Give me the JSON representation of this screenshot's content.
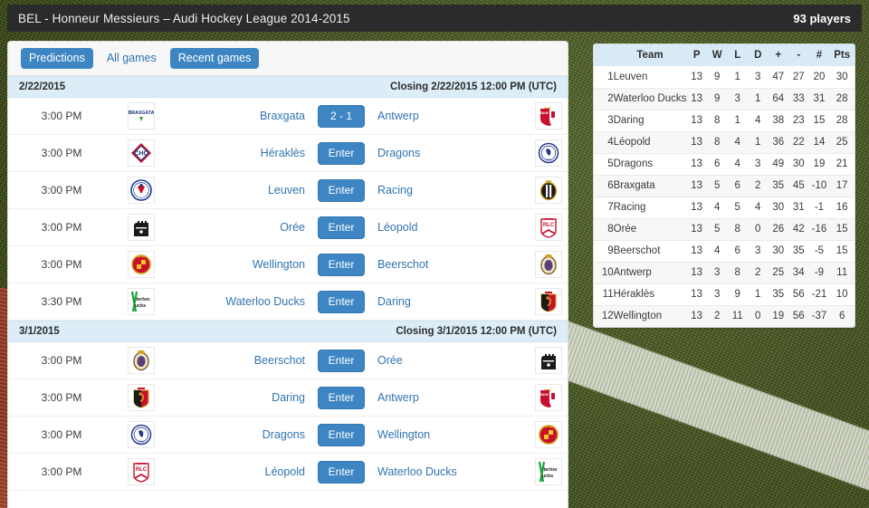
{
  "topbar": {
    "title": "BEL - Honneur Messieurs – Audi Hockey League 2014-2015",
    "players": "93 players"
  },
  "tabs": [
    {
      "label": "Predictions",
      "active": true
    },
    {
      "label": "All games",
      "active": false
    },
    {
      "label": "Recent games",
      "active": true
    }
  ],
  "sections": [
    {
      "date": "2/22/2015",
      "closing": "Closing 2/22/2015 12:00 PM (UTC)",
      "games": [
        {
          "time": "3:00 PM",
          "home": "Braxgata",
          "away": "Antwerp",
          "button": "2 - 1",
          "home_crest": "braxgata",
          "away_crest": "antwerp"
        },
        {
          "time": "3:00 PM",
          "home": "Héraklès",
          "away": "Dragons",
          "button": "Enter",
          "home_crest": "herakles",
          "away_crest": "dragons"
        },
        {
          "time": "3:00 PM",
          "home": "Leuven",
          "away": "Racing",
          "button": "Enter",
          "home_crest": "leuven",
          "away_crest": "racing"
        },
        {
          "time": "3:00 PM",
          "home": "Orée",
          "away": "Léopold",
          "button": "Enter",
          "home_crest": "oree",
          "away_crest": "leopold"
        },
        {
          "time": "3:00 PM",
          "home": "Wellington",
          "away": "Beerschot",
          "button": "Enter",
          "home_crest": "wellington",
          "away_crest": "beerschot"
        },
        {
          "time": "3:30 PM",
          "home": "Waterloo Ducks",
          "away": "Daring",
          "button": "Enter",
          "home_crest": "waterloo",
          "away_crest": "daring"
        }
      ]
    },
    {
      "date": "3/1/2015",
      "closing": "Closing 3/1/2015 12:00 PM (UTC)",
      "games": [
        {
          "time": "3:00 PM",
          "home": "Beerschot",
          "away": "Orée",
          "button": "Enter",
          "home_crest": "beerschot",
          "away_crest": "oree"
        },
        {
          "time": "3:00 PM",
          "home": "Daring",
          "away": "Antwerp",
          "button": "Enter",
          "home_crest": "daring",
          "away_crest": "antwerp"
        },
        {
          "time": "3:00 PM",
          "home": "Dragons",
          "away": "Wellington",
          "button": "Enter",
          "home_crest": "dragons",
          "away_crest": "wellington"
        },
        {
          "time": "3:00 PM",
          "home": "Léopold",
          "away": "Waterloo Ducks",
          "button": "Enter",
          "home_crest": "leopold",
          "away_crest": "waterloo"
        }
      ]
    }
  ],
  "standings": {
    "headers": [
      "",
      "Team",
      "P",
      "W",
      "L",
      "D",
      "+",
      "-",
      "#",
      "Pts"
    ],
    "rows": [
      {
        "rank": "1",
        "team": "Leuven",
        "p": "13",
        "w": "9",
        "l": "1",
        "d": "3",
        "gf": "47",
        "ga": "27",
        "gd": "20",
        "pts": "30"
      },
      {
        "rank": "2",
        "team": "Waterloo Ducks",
        "p": "13",
        "w": "9",
        "l": "3",
        "d": "1",
        "gf": "64",
        "ga": "33",
        "gd": "31",
        "pts": "28"
      },
      {
        "rank": "3",
        "team": "Daring",
        "p": "13",
        "w": "8",
        "l": "1",
        "d": "4",
        "gf": "38",
        "ga": "23",
        "gd": "15",
        "pts": "28"
      },
      {
        "rank": "4",
        "team": "Léopold",
        "p": "13",
        "w": "8",
        "l": "4",
        "d": "1",
        "gf": "36",
        "ga": "22",
        "gd": "14",
        "pts": "25"
      },
      {
        "rank": "5",
        "team": "Dragons",
        "p": "13",
        "w": "6",
        "l": "4",
        "d": "3",
        "gf": "49",
        "ga": "30",
        "gd": "19",
        "pts": "21"
      },
      {
        "rank": "6",
        "team": "Braxgata",
        "p": "13",
        "w": "5",
        "l": "6",
        "d": "2",
        "gf": "35",
        "ga": "45",
        "gd": "-10",
        "pts": "17"
      },
      {
        "rank": "7",
        "team": "Racing",
        "p": "13",
        "w": "4",
        "l": "5",
        "d": "4",
        "gf": "30",
        "ga": "31",
        "gd": "-1",
        "pts": "16"
      },
      {
        "rank": "8",
        "team": "Orée",
        "p": "13",
        "w": "5",
        "l": "8",
        "d": "0",
        "gf": "26",
        "ga": "42",
        "gd": "-16",
        "pts": "15"
      },
      {
        "rank": "9",
        "team": "Beerschot",
        "p": "13",
        "w": "4",
        "l": "6",
        "d": "3",
        "gf": "30",
        "ga": "35",
        "gd": "-5",
        "pts": "15"
      },
      {
        "rank": "10",
        "team": "Antwerp",
        "p": "13",
        "w": "3",
        "l": "8",
        "d": "2",
        "gf": "25",
        "ga": "34",
        "gd": "-9",
        "pts": "11"
      },
      {
        "rank": "11",
        "team": "Héraklès",
        "p": "13",
        "w": "3",
        "l": "9",
        "d": "1",
        "gf": "35",
        "ga": "56",
        "gd": "-21",
        "pts": "10"
      },
      {
        "rank": "12",
        "team": "Wellington",
        "p": "13",
        "w": "2",
        "l": "11",
        "d": "0",
        "gf": "19",
        "ga": "56",
        "gd": "-37",
        "pts": "6"
      }
    ]
  },
  "colors": {
    "accent": "#3e86c3",
    "link": "#3174b0",
    "band": "#ddedf7",
    "table_header": "#d8eaf5",
    "topbar": "#2b2b2b",
    "field": "#46541f"
  }
}
